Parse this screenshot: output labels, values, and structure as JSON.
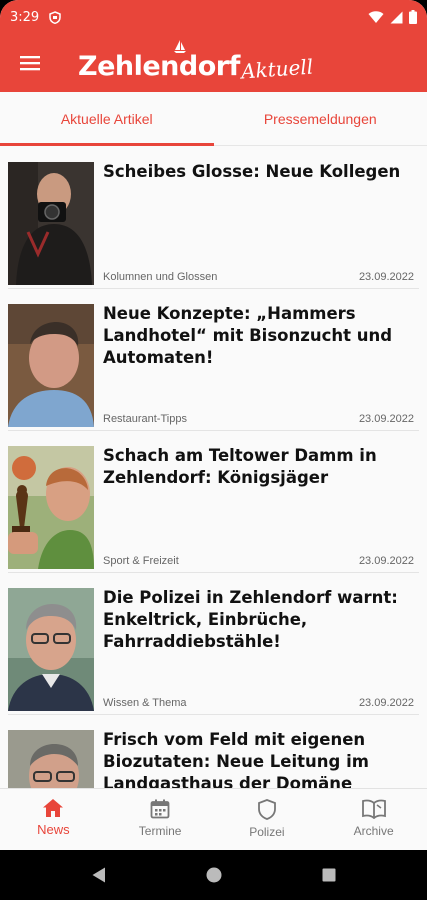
{
  "status": {
    "time": "3:29"
  },
  "app": {
    "logo_main": "Zehlendorf",
    "logo_script": "Aktuell"
  },
  "tabs": [
    {
      "label": "Aktuelle Artikel",
      "active": true
    },
    {
      "label": "Pressemeldungen",
      "active": false
    }
  ],
  "articles": [
    {
      "title": "Scheibes Glosse: Neue Kollegen",
      "category": "Kolumnen und Glossen",
      "date": "23.09.2022"
    },
    {
      "title": "Neue Konzepte: „Hammers Landhotel“ mit Bisonzucht und Automaten!",
      "category": "Restaurant-Tipps",
      "date": "23.09.2022"
    },
    {
      "title": "Schach am Teltower Damm in Zehlendorf: Königsjäger",
      "category": "Sport & Freizeit",
      "date": "23.09.2022"
    },
    {
      "title": "Die Polizei in Zehlendorf warnt: Enkeltrick, Einbrüche, Fahrraddiebstähle!",
      "category": "Wissen & Thema",
      "date": "23.09.2022"
    },
    {
      "title": "Frisch vom Feld mit eigenen Biozutaten: Neue Leitung im Landgasthaus der Domäne Dahlem!",
      "category": "",
      "date": ""
    }
  ],
  "bottom_nav": [
    {
      "label": "News",
      "icon": "home-icon",
      "active": true
    },
    {
      "label": "Termine",
      "icon": "calendar-icon",
      "active": false
    },
    {
      "label": "Polizei",
      "icon": "shield-icon",
      "active": false
    },
    {
      "label": "Archive",
      "icon": "book-icon",
      "active": false
    }
  ],
  "colors": {
    "accent": "#e8453a",
    "text": "#111111",
    "meta": "#666666"
  }
}
